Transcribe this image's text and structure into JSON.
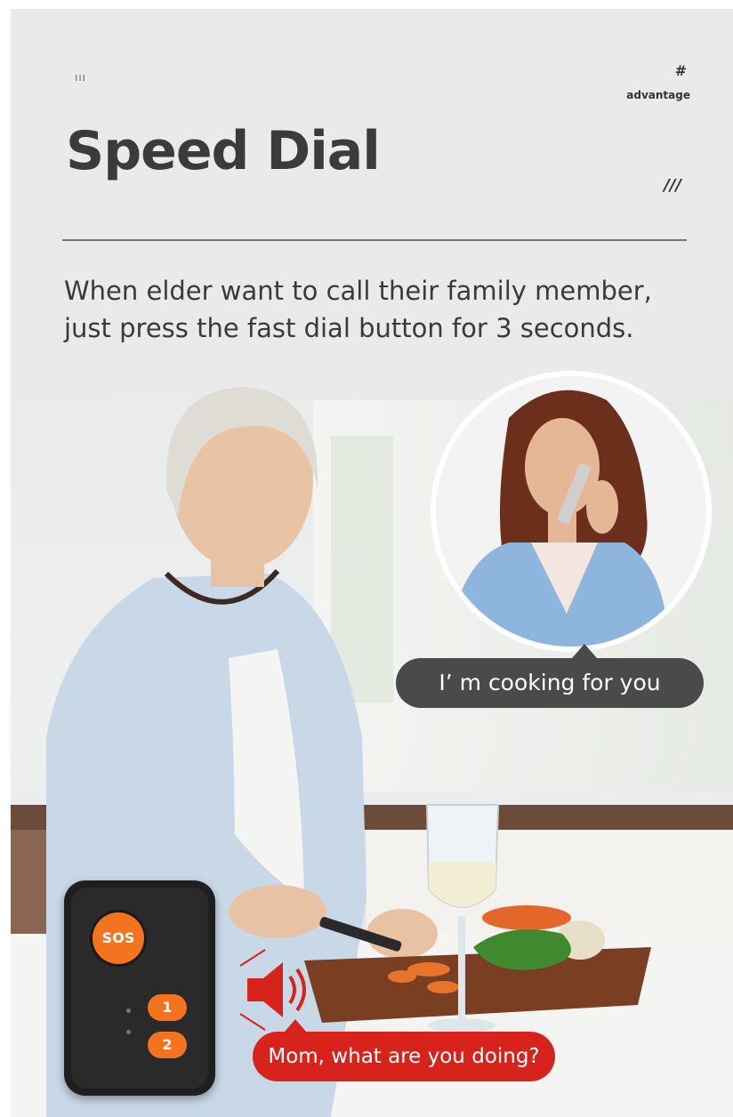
{
  "header": {
    "deco_marks": "ııı",
    "hash": "#",
    "tag": "advantage",
    "title": "Speed Dial",
    "slashes": "///"
  },
  "description": "When elder want to call their family member, just press the fast dial button for 3 seconds.",
  "bubbles": {
    "daughter_reply": "I’  m cooking for you",
    "elder_call": "Mom, what are you doing?"
  },
  "device": {
    "sos_label": "SOS",
    "key1_label": "1",
    "key2_label": "2"
  },
  "colors": {
    "accent_orange": "#f4731f",
    "bubble_red": "#d8231c",
    "bubble_dark": "#4a4a4a",
    "background": "#e9eaea"
  }
}
